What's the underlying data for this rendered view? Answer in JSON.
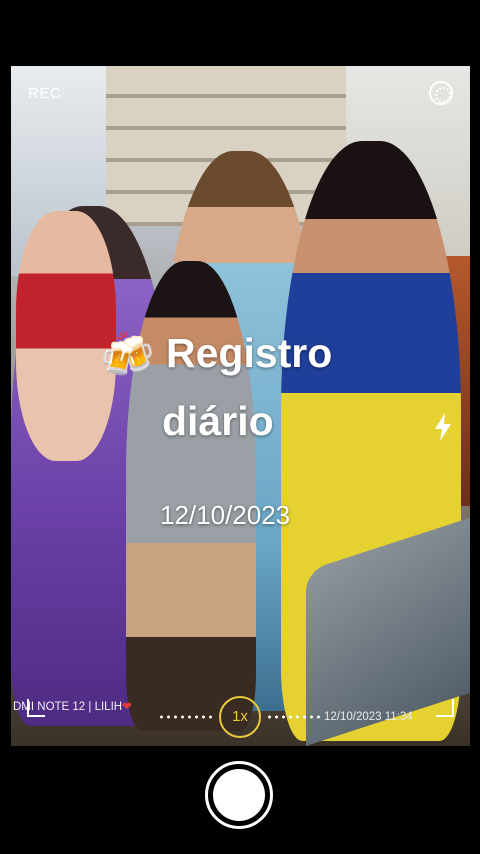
{
  "status": {
    "rec_label": "REC"
  },
  "sticker": {
    "emoji": "🍻",
    "line1": "Registro",
    "line2": "diário",
    "date": "12/10/2023"
  },
  "watermark": {
    "device": "DMI NOTE 12 | LILIH",
    "heart": "❤"
  },
  "zoom": {
    "label": "1x"
  },
  "datestamp": {
    "text": "12/10/2023  11:34"
  },
  "icons": {
    "lens": "live-lens-icon",
    "flash": "flash-icon",
    "shutter": "shutter-button"
  },
  "colors": {
    "zoom_accent": "#e8c93a",
    "background": "#000000"
  }
}
